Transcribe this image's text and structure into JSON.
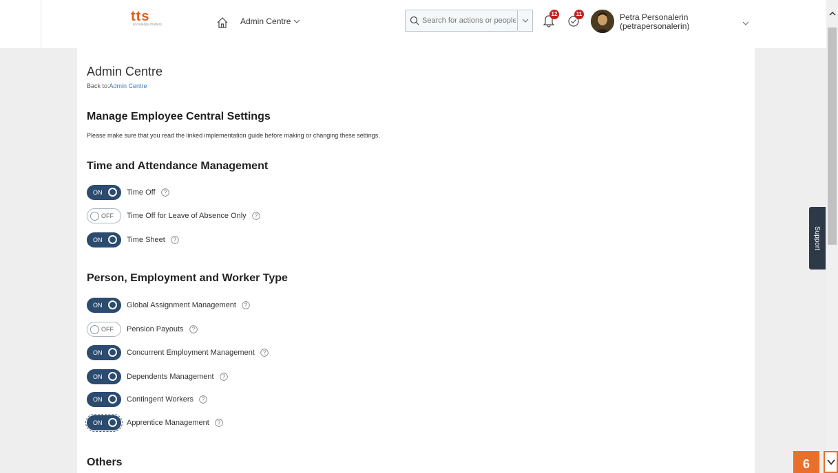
{
  "header": {
    "logo_main": "tts",
    "logo_sub": "knowledge matters",
    "nav_label": "Admin Centre",
    "search_placeholder": "Search for actions or people",
    "notifications_count": "12",
    "tasks_count": "11",
    "user_name": "Petra Personalerin",
    "user_id": "(petrapersonalerin)"
  },
  "page": {
    "title": "Admin Centre",
    "back_prefix": "Back to:",
    "back_link": "Admin Centre",
    "heading": "Manage Employee Central Settings",
    "description": "Please make sure that you read the linked implementation guide before making or changing these settings."
  },
  "sections": {
    "time_attendance": {
      "title": "Time and Attendance Management",
      "items": [
        {
          "label": "Time Off",
          "state": "ON"
        },
        {
          "label": "Time Off for Leave of Absence Only",
          "state": "OFF"
        },
        {
          "label": "Time Sheet",
          "state": "ON"
        }
      ]
    },
    "person_employment": {
      "title": "Person, Employment and Worker Type",
      "items": [
        {
          "label": "Global Assignment Management",
          "state": "ON"
        },
        {
          "label": "Pension Payouts",
          "state": "OFF"
        },
        {
          "label": "Concurrent Employment Management",
          "state": "ON"
        },
        {
          "label": "Dependents Management",
          "state": "ON"
        },
        {
          "label": "Contingent Workers",
          "state": "ON"
        },
        {
          "label": "Apprentice Management",
          "state": "ON"
        }
      ]
    },
    "others": {
      "title": "Others"
    }
  },
  "support_label": "Support",
  "page_badge": "6",
  "colors": {
    "toggle_on": "#2b4b6f",
    "brand": "#e35a1b",
    "badge": "#c41f1f",
    "accent_orange": "#e8702a"
  }
}
